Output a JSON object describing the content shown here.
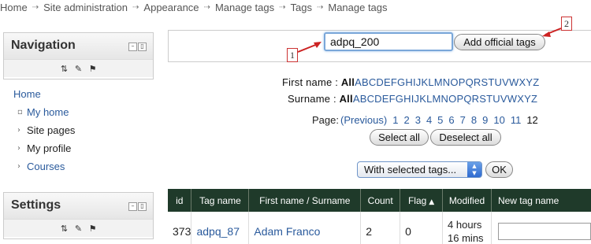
{
  "breadcrumb": [
    "Home",
    "Site administration",
    "Appearance",
    "Manage tags",
    "Tags",
    "Manage tags"
  ],
  "navigation": {
    "title": "Navigation",
    "home": "Home",
    "items": [
      "My home",
      "Site pages",
      "My profile",
      "Courses"
    ]
  },
  "settings": {
    "title": "Settings"
  },
  "add_tags": {
    "input_value": "adpq_200",
    "button": "Add official tags"
  },
  "callouts": [
    "1",
    "2"
  ],
  "filter": {
    "first_name_label": "First name :",
    "surname_label": "Surname :",
    "all": "All",
    "letters": [
      "A",
      "B",
      "C",
      "D",
      "E",
      "F",
      "G",
      "H",
      "I",
      "J",
      "K",
      "L",
      "M",
      "N",
      "O",
      "P",
      "Q",
      "R",
      "S",
      "T",
      "U",
      "V",
      "W",
      "X",
      "Y",
      "Z"
    ]
  },
  "pager": {
    "label": "Page:",
    "previous": "(Previous)",
    "pages": [
      "1",
      "2",
      "3",
      "4",
      "5",
      "6",
      "7",
      "8",
      "9",
      "10",
      "11"
    ],
    "current": "12"
  },
  "buttons": {
    "select_all": "Select all",
    "deselect_all": "Deselect all",
    "ok": "OK"
  },
  "bulk_select": {
    "value": "With selected tags..."
  },
  "table": {
    "headers": [
      "id",
      "Tag name",
      "First name  /  Surname",
      "Count",
      "Flag",
      "Modified",
      "New tag name"
    ],
    "rows": [
      {
        "id": "373",
        "tag": "adpq_87",
        "owner": "Adam Franco",
        "count": "2",
        "flag": "0",
        "modified_1": "4 hours",
        "modified_2": "16 mins"
      }
    ]
  },
  "colors": {
    "link": "#2a5a9c",
    "table_header": "#1f3a2a",
    "callout_border": "#cc3333"
  }
}
